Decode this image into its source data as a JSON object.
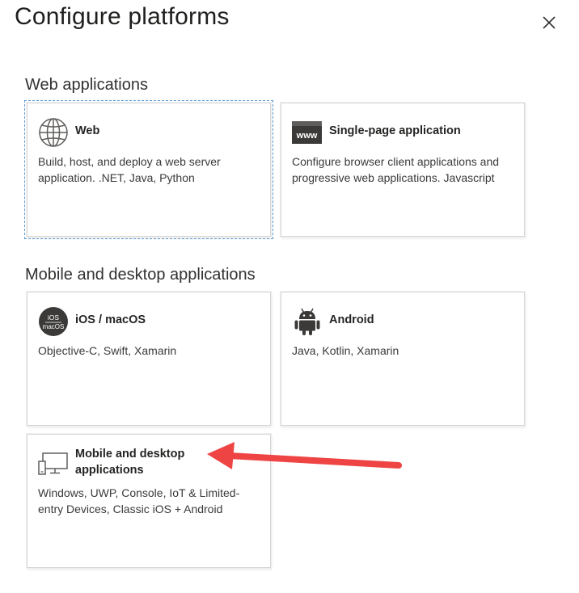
{
  "header": {
    "title": "Configure platforms",
    "close_icon": "close-icon"
  },
  "sections": [
    {
      "title": "Web applications",
      "cards": [
        {
          "icon": "globe-icon",
          "title": "Web",
          "description": "Build, host, and deploy a web server application. .NET, Java, Python"
        },
        {
          "icon": "www-icon",
          "icon_text": "www",
          "title": "Single-page application",
          "description": "Configure browser client applications and progressive web applications. Javascript"
        }
      ]
    },
    {
      "title": "Mobile and desktop applications",
      "cards": [
        {
          "icon": "ios-macos-icon",
          "icon_text_top": "iOS",
          "icon_text_bottom": "macOS",
          "title": "iOS / macOS",
          "description": "Objective-C, Swift, Xamarin"
        },
        {
          "icon": "android-icon",
          "title": "Android",
          "description": "Java, Kotlin, Xamarin"
        },
        {
          "icon": "desktop-device-icon",
          "title": "Mobile and desktop applications",
          "description": "Windows, UWP, Console, IoT & Limited-entry Devices, Classic iOS + Android"
        }
      ]
    }
  ],
  "annotation": {
    "type": "red-arrow",
    "color": "#ef4444",
    "points_to": "Mobile and desktop applications"
  },
  "colors": {
    "focus_outline": "#5b9bd5",
    "card_border": "#d6d6d6",
    "icon_dark": "#3b3a39",
    "arrow": "#ef4444"
  }
}
